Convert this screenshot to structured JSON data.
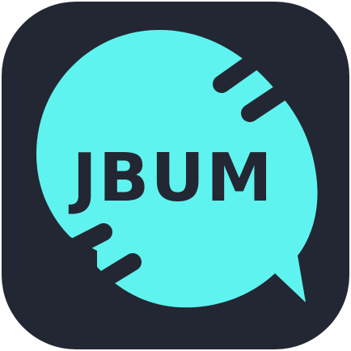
{
  "app_icon": {
    "wordmark": "JBUM",
    "background_color": "#232733",
    "bubble_color": "#5FF3EF",
    "text_color": "#232733",
    "icon": "chat-bubble-icon"
  }
}
